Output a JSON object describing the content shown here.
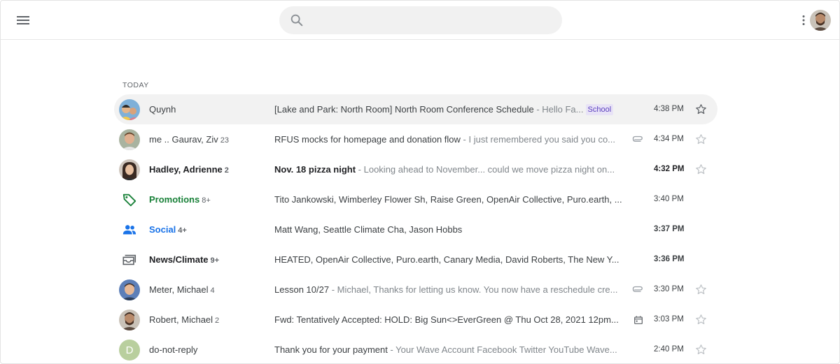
{
  "search": {
    "placeholder": "",
    "value": ""
  },
  "icons": {
    "menu": "hamburger-menu-icon",
    "search": "magnifier-icon",
    "more": "vertical-dots-icon",
    "star": "star-outline-icon",
    "attachment": "paperclip-icon",
    "calendar": "calendar-icon",
    "promotions": "tag-icon",
    "social": "people-icon",
    "news": "mail-stack-icon"
  },
  "colors": {
    "promotions": "#188038",
    "social": "#1a73e8",
    "school_tag_bg": "#e8e3f6",
    "school_tag_text": "#5b3fbf",
    "row_hover": "#f2f2f2"
  },
  "section": {
    "label": "TODAY"
  },
  "threads": [
    {
      "sender": "Quynh",
      "count": "",
      "subject": "[Lake and Park: North Room] North Room Conference Schedule",
      "snippet": " - Hello Fa...",
      "tag": "School",
      "time": "4:38 PM",
      "unread": false,
      "attachment": "",
      "starred": false
    },
    {
      "sender": "me .. Gaurav, Ziv",
      "count": "23",
      "subject": "RFUS mocks for homepage and donation flow",
      "snippet": " - I just remembered you said you co...",
      "tag": "",
      "time": "4:34 PM",
      "unread": false,
      "attachment": "paperclip",
      "starred": false
    },
    {
      "sender": "Hadley, Adrienne",
      "count": "2",
      "subject": "Nov. 18 pizza night",
      "snippet": " - Looking ahead to November... could we move pizza night on...",
      "tag": "",
      "time": "4:32 PM",
      "unread": true,
      "attachment": "",
      "starred": false
    },
    {
      "sender": "Promotions",
      "count": "8+",
      "subject": "Tito Jankowski, Wimberley Flower Sh, Raise Green, OpenAir Collective, Puro.earth, ...",
      "snippet": "",
      "tag": "",
      "time": "3:40 PM",
      "unread": false,
      "bundle": "promotions"
    },
    {
      "sender": "Social",
      "count": "4+",
      "subject": "Matt Wang, Seattle Climate Cha, Jason Hobbs",
      "snippet": "",
      "tag": "",
      "time": "3:37 PM",
      "unread": true,
      "bundle": "social"
    },
    {
      "sender": "News/Climate",
      "count": "9+",
      "subject": "HEATED, OpenAir Collective, Puro.earth, Canary Media, David Roberts, The New Y...",
      "snippet": "",
      "tag": "",
      "time": "3:36 PM",
      "unread": true,
      "bundle": "news"
    },
    {
      "sender": "Meter, Michael",
      "count": "4",
      "subject": "Lesson 10/27",
      "snippet": " - Michael, Thanks for letting us know. You now have a reschedule cre...",
      "tag": "",
      "time": "3:30 PM",
      "unread": false,
      "attachment": "paperclip",
      "starred": false
    },
    {
      "sender": "Robert, Michael",
      "count": "2",
      "subject": "Fwd: Tentatively Accepted: HOLD: Big Sun<>EverGreen @ Thu Oct 28, 2021 12pm...",
      "snippet": "",
      "tag": "",
      "time": "3:03 PM",
      "unread": false,
      "attachment": "calendar",
      "starred": false
    },
    {
      "sender": "do-not-reply",
      "count": "",
      "subject": "Thank you for your payment",
      "snippet": " - Your Wave Account Facebook Twitter YouTube Wave...",
      "tag": "",
      "time": "2:40 PM",
      "unread": false,
      "attachment": "",
      "starred": false,
      "avatar_letter": "D"
    }
  ]
}
